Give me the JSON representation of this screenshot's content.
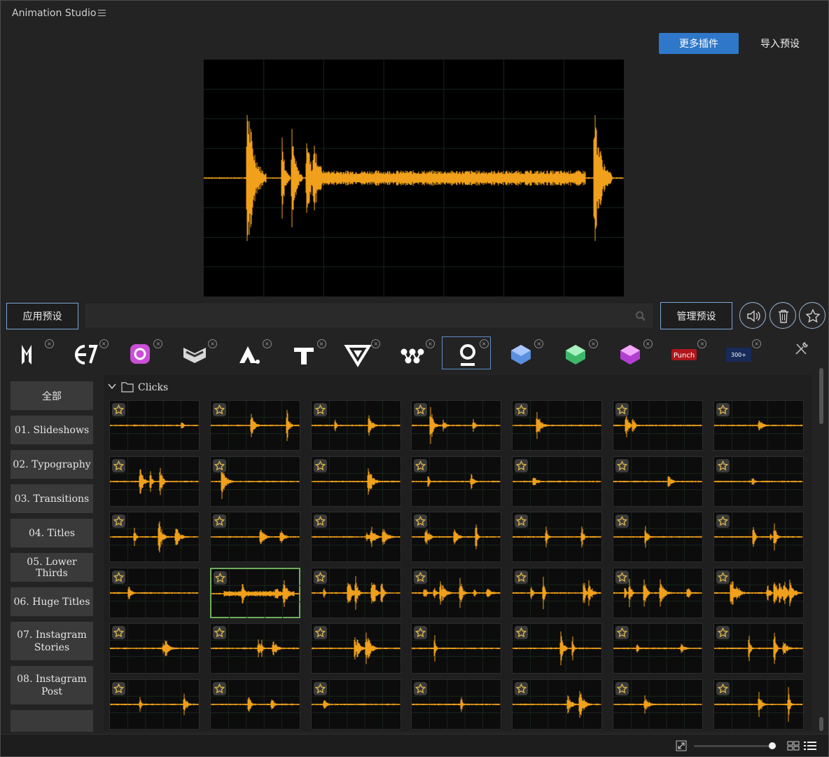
{
  "app": {
    "title": "Animation Studio"
  },
  "header": {
    "more_plugins": "更多插件",
    "import_preset": "导入预设"
  },
  "toolbar": {
    "apply_preset": "应用预设",
    "search_placeholder": "",
    "manage_preset": "管理预设",
    "sound_icon": "speaker-icon",
    "trash_icon": "trash-icon",
    "favorite_icon": "star-icon"
  },
  "plugins": [
    {
      "id": "m",
      "icon": "letter-m-icon"
    },
    {
      "id": "e",
      "icon": "e7-logo-icon"
    },
    {
      "id": "insta",
      "icon": "instagram-icon"
    },
    {
      "id": "chevron",
      "icon": "chevron-badge-icon"
    },
    {
      "id": "a",
      "icon": "letter-a-icon"
    },
    {
      "id": "t",
      "icon": "letter-t-icon"
    },
    {
      "id": "v",
      "icon": "triangle-v-icon"
    },
    {
      "id": "nodes",
      "icon": "nodes-icon"
    },
    {
      "id": "sound",
      "icon": "sound-pin-icon",
      "selected": true
    },
    {
      "id": "cube-blue",
      "icon": "cube-blue-icon"
    },
    {
      "id": "cube-green",
      "icon": "cube-green-icon"
    },
    {
      "id": "cube-pink",
      "icon": "cube-pink-icon"
    },
    {
      "id": "punch",
      "icon": "punch-logo-icon",
      "text": "Punch"
    },
    {
      "id": "transitions",
      "icon": "transitions-badge-icon",
      "text": "300+"
    }
  ],
  "sidebar": {
    "categories": [
      {
        "label": "全部"
      },
      {
        "label": "01. Slideshows"
      },
      {
        "label": "02. Typography"
      },
      {
        "label": "03. Transitions"
      },
      {
        "label": "04. Titles"
      },
      {
        "label": "05. Lower Thirds"
      },
      {
        "label": "06. Huge Titles"
      },
      {
        "label": "07. Instagram Stories"
      },
      {
        "label": "08. Instagram Post"
      }
    ]
  },
  "folder": {
    "name": "Clicks"
  },
  "colors": {
    "accent": "#2f78c9",
    "waveform": "#f0a01a",
    "selected_tile": "#6fae5a"
  },
  "grid": {
    "rows": 6,
    "cols": 7,
    "selected_index": 22
  },
  "footer": {
    "fit_icon": "fit-icon",
    "grid_view_icon": "grid-view-icon",
    "list_view_icon": "list-view-icon",
    "zoom_level": 0.95
  }
}
